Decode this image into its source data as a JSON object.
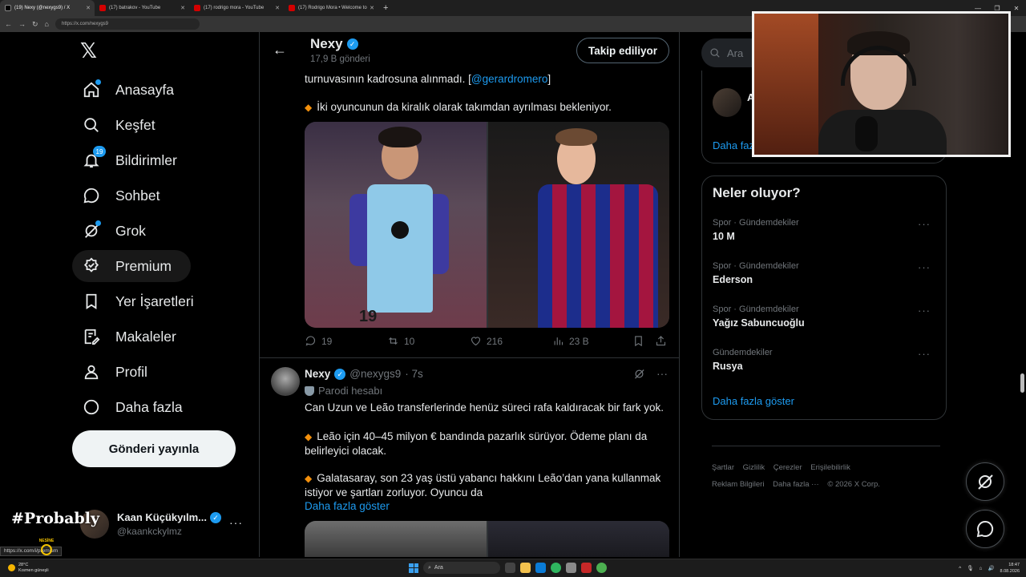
{
  "browser": {
    "tabs": [
      {
        "title": "(19) Nexy (@nexygs9) / X",
        "favicon": "x-icon",
        "active": true
      },
      {
        "title": "(17) batrakov - YouTube",
        "favicon": "youtube-icon",
        "active": false
      },
      {
        "title": "(17) rodrigo mora - YouTube",
        "favicon": "youtube-icon",
        "active": false
      },
      {
        "title": "(17) Rodrigo Mora • Welcome to",
        "favicon": "youtube-icon",
        "active": false
      }
    ],
    "url": "https://x.com/nexygs9",
    "status_url": "https://x.com/i/premium"
  },
  "leftnav": {
    "items": [
      {
        "label": "Anasayfa",
        "icon": "home-icon",
        "dot": true
      },
      {
        "label": "Keşfet",
        "icon": "search-icon"
      },
      {
        "label": "Bildirimler",
        "icon": "bell-icon",
        "badge": "19"
      },
      {
        "label": "Sohbet",
        "icon": "chat-icon"
      },
      {
        "label": "Grok",
        "icon": "grok-icon",
        "dot": true
      },
      {
        "label": "Premium",
        "icon": "premium-icon"
      },
      {
        "label": "Yer İşaretleri",
        "icon": "bookmark-icon"
      },
      {
        "label": "Makaleler",
        "icon": "article-icon"
      },
      {
        "label": "Profil",
        "icon": "profile-icon"
      },
      {
        "label": "Daha fazla",
        "icon": "more-circle-icon"
      }
    ],
    "post_button": "Gönderi yayınla",
    "account": {
      "name": "Kaan Küçükyılm...",
      "handle": "@kaankckylmz"
    }
  },
  "overlay": {
    "hashtag": "#Probably",
    "sponsor": "NESİNE"
  },
  "profile_header": {
    "name": "Nexy",
    "posts": "17,9 B gönderi",
    "follow_label": "Takip ediliyor"
  },
  "tweet1": {
    "text_tail": "turnuvasının kadrosuna alınmadı. [",
    "mention": "@gerardromero",
    "text_close": "]",
    "bullet": "İki oyuncunun da kiralık olarak takımdan ayrılması bekleniyor.",
    "photo_left_number": "19",
    "stats": {
      "replies": "19",
      "reposts": "10",
      "likes": "216",
      "views": "23 B"
    }
  },
  "tweet2": {
    "name": "Nexy",
    "handle": "@nexygs9",
    "time": "· 7s",
    "label": "Parodi hesabı",
    "line1": "Can Uzun ve Leão transferlerinde henüz süreci rafa kaldıracak bir fark yok.",
    "bullet1": "Leão için 40–45 milyon € bandında pazarlık sürüyor. Ödeme planı da belirleyici olacak.",
    "bullet2": "Galatasaray, son 23 yaş üstü yabancı hakkını Leão’dan yana kullanmak istiyor ve şartları zorluyor. Oyuncu da",
    "show_more": "Daha fazla göster"
  },
  "sidebar": {
    "search_placeholder": "Ara",
    "who_to_follow": {
      "name_initial": "A",
      "handle_initial": "@",
      "show_more": "Daha fazla göster"
    },
    "trends_title": "Neler oluyor?",
    "trends": [
      {
        "category": "Spor · Gündemdekiler",
        "title": "10 M"
      },
      {
        "category": "Spor · Gündemdekiler",
        "title": "Ederson"
      },
      {
        "category": "Spor · Gündemdekiler",
        "title": "Yağız Sabuncuoğlu"
      },
      {
        "category": "Gündemdekiler",
        "title": "Rusya"
      }
    ],
    "trends_more": "Daha fazla göster",
    "footer": [
      "Şartlar",
      "Gizlilik",
      "Çerezler",
      "Erişilebilirlik",
      "Reklam Bilgileri",
      "Daha fazla ···",
      "© 2026 X Corp."
    ]
  },
  "taskbar": {
    "weather_temp": "28°C",
    "weather_desc": "Kısmen güneşli",
    "search": "Ara",
    "time": "18:47",
    "date": "8.08.2026"
  },
  "colors": {
    "accent": "#1d9bf0",
    "background": "#000000",
    "border": "#2f3336",
    "muted": "#71767b",
    "bullet": "#f4900c"
  }
}
